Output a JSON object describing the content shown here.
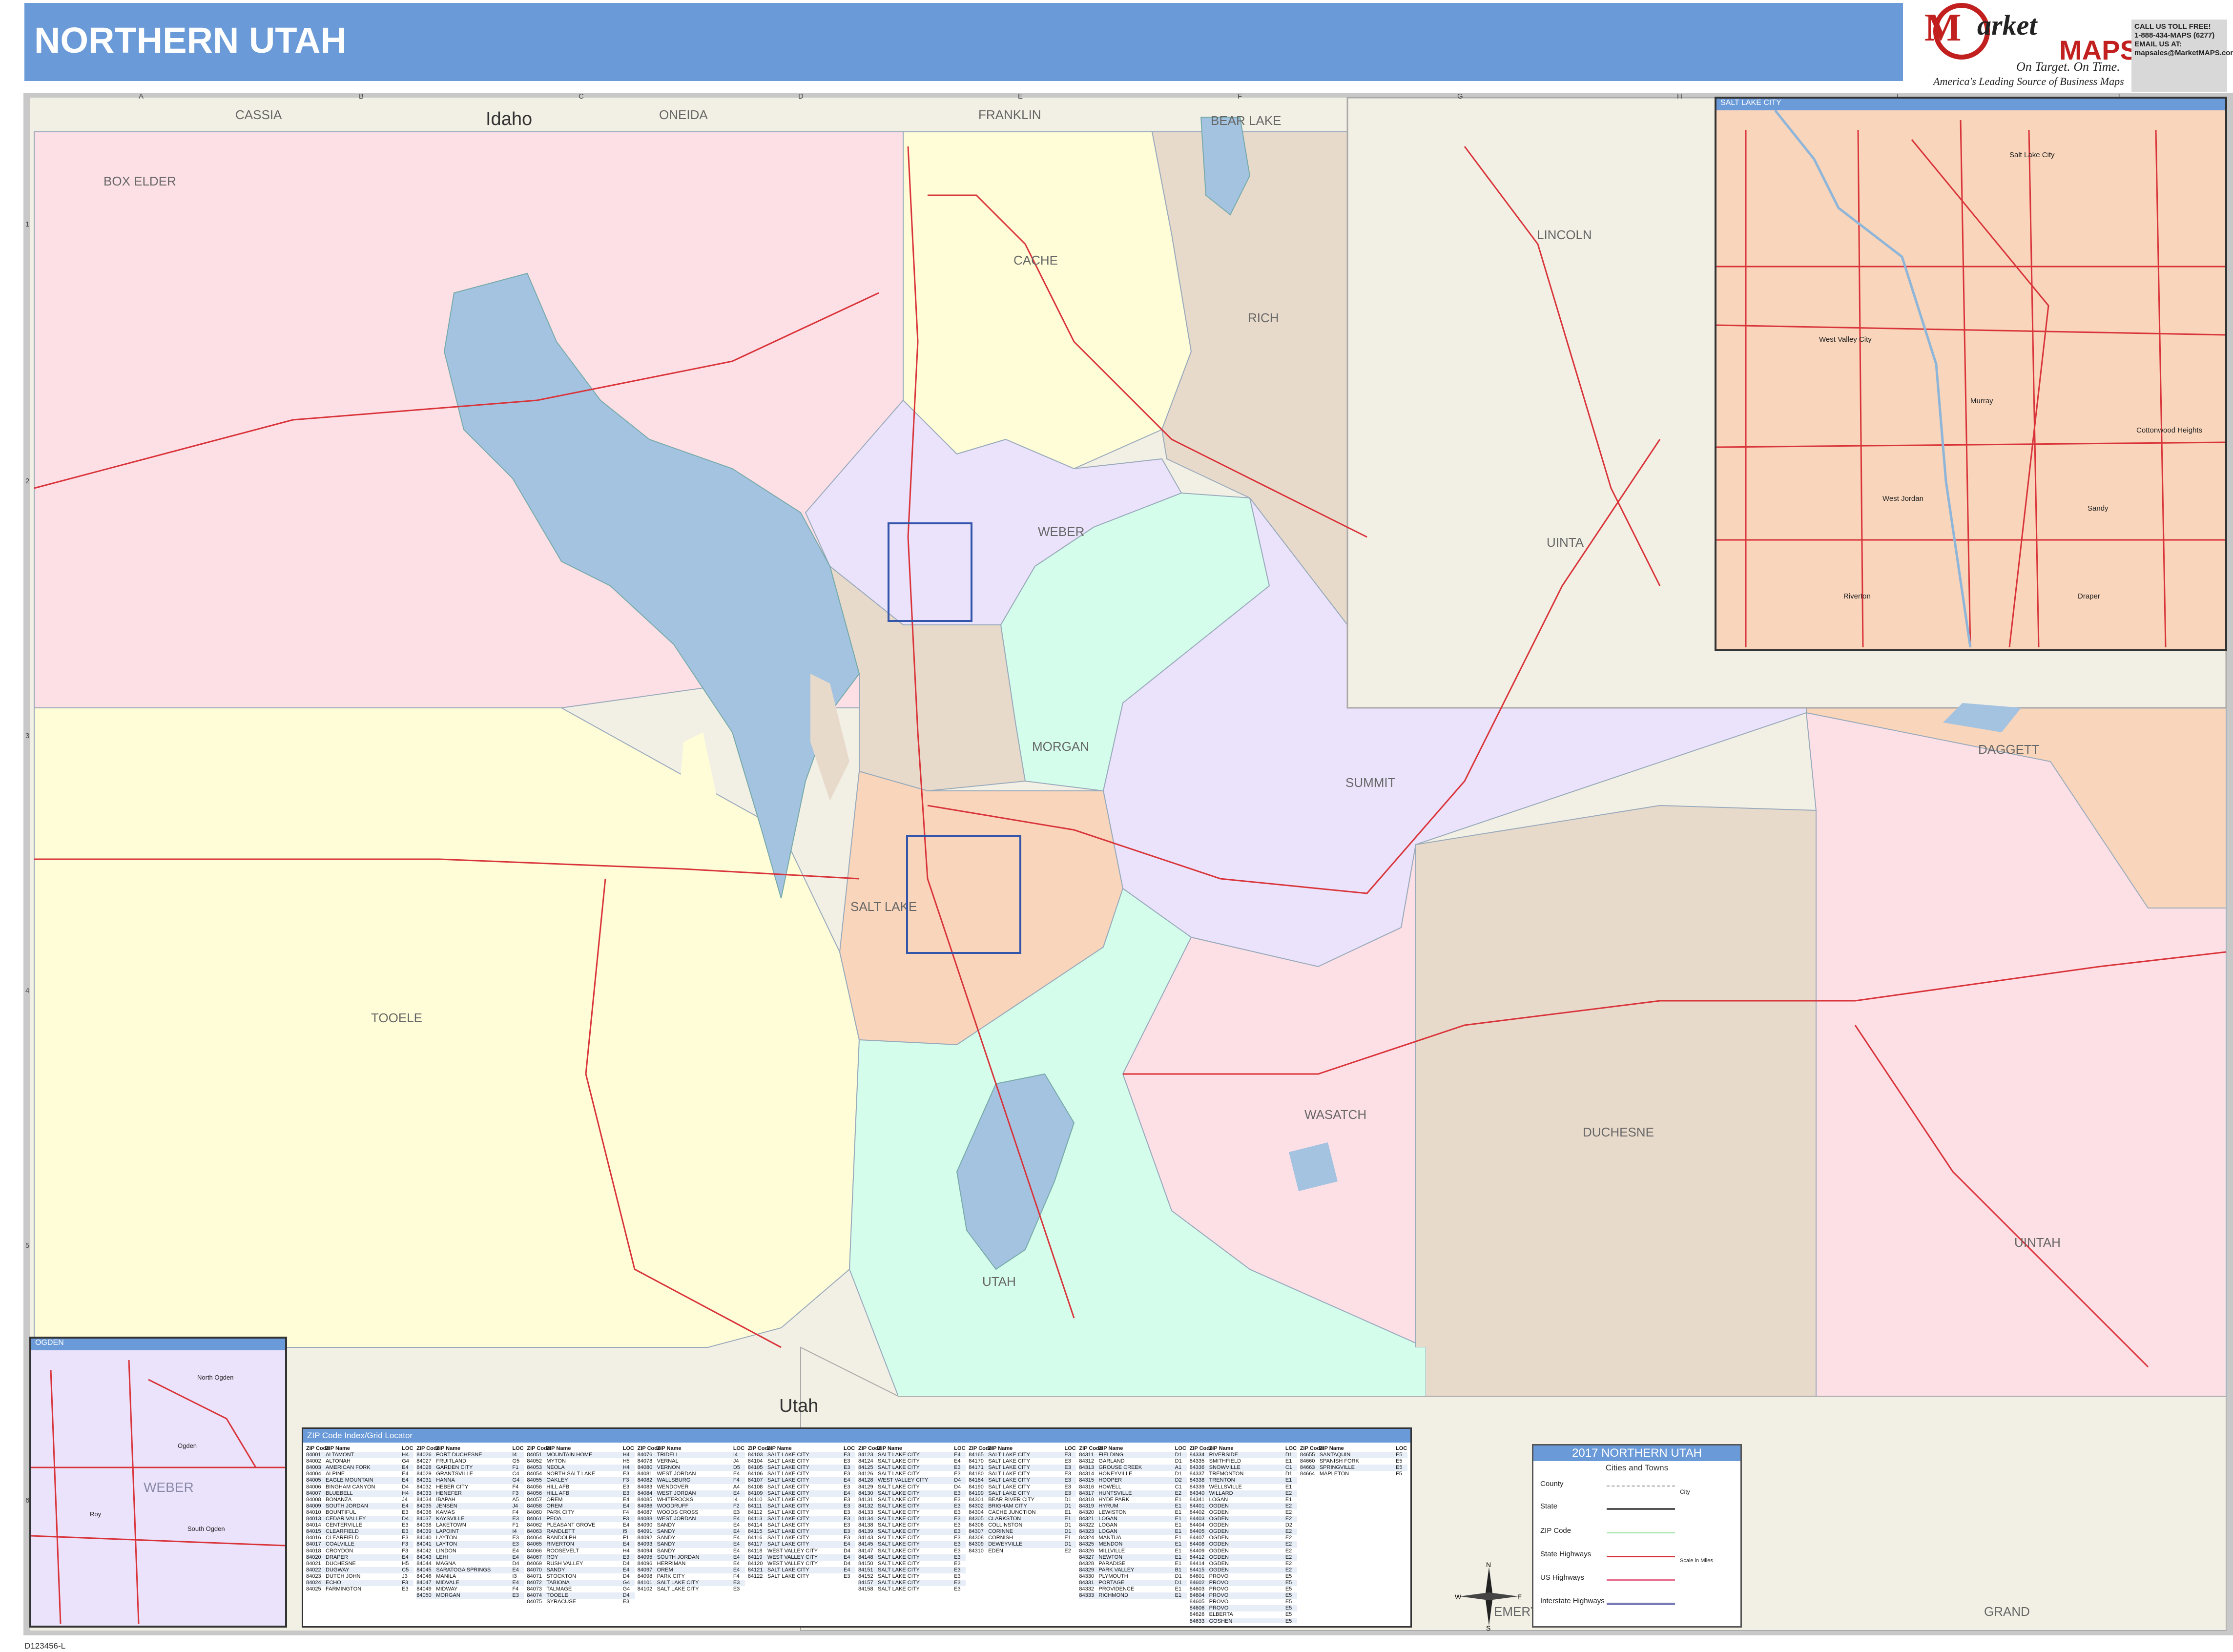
{
  "title": "NORTHERN UTAH",
  "logo": {
    "m_letter": "M",
    "market": "arket",
    "maps": "MAPS",
    "tagline": "On Target. On Time.",
    "subtag": "America's Leading Source of Business Maps"
  },
  "contact": {
    "line1": "CALL US TOLL FREE!",
    "line2": "1-888-434-MAPS (6277)",
    "line3": "EMAIL US AT:",
    "line4": "mapsales@MarketMAPS.com"
  },
  "footer_code": "D123456-L",
  "grid": {
    "columns": [
      "A",
      "B",
      "C",
      "D",
      "E",
      "F",
      "G",
      "H",
      "I",
      "J"
    ],
    "rows": [
      "1",
      "2",
      "3",
      "4",
      "5",
      "6"
    ]
  },
  "labels": {
    "states": [
      "Idaho",
      "Utah"
    ],
    "counties": [
      "CASSIA",
      "ONEIDA",
      "FRANKLIN",
      "BEAR LAKE",
      "BOX ELDER",
      "CACHE",
      "RICH",
      "LINCOLN",
      "UINTA",
      "WEBER",
      "MORGAN",
      "SUMMIT",
      "DAGGETT",
      "SALT LAKE",
      "TOOELE",
      "WASATCH",
      "DUCHESNE",
      "UINTAH",
      "UTAH",
      "EMERY",
      "GRAND"
    ]
  },
  "colors": {
    "box_elder": "#fde0e6",
    "tooele": "#fefdd8",
    "cache": "#fefdd8",
    "rich": "#e8dacb",
    "weber": "#ebe3fb",
    "morgan": "#d5fdeb",
    "summit": "#ebe3fb",
    "salt_lake": "#f8d5bb",
    "utah": "#d5fdeb",
    "wasatch": "#fde0e6",
    "duchesne": "#e8dacb",
    "uintah": "#fde0e6",
    "daggett": "#f8d5bb",
    "wyoming": "#f2efe4",
    "water": "#a3c3e0",
    "road": "#d9343a",
    "title_bar": "#6a9ad8"
  },
  "insets": {
    "slc": {
      "title": "SALT LAKE CITY",
      "places": [
        "Salt Lake City",
        "West Valley City",
        "Murray",
        "Sandy",
        "West Jordan",
        "Draper",
        "Cottonwood Heights",
        "Riverton"
      ]
    },
    "ogden": {
      "title": "OGDEN",
      "county": "WEBER",
      "places": [
        "North Ogden",
        "Ogden",
        "Roy",
        "South Ogden"
      ]
    }
  },
  "zip_index": {
    "title": "ZIP Code Index/Grid Locator",
    "header": [
      "ZIP Code",
      "ZIP Name",
      "LOC"
    ],
    "columns": [
      [
        [
          "84001",
          "ALTAMONT",
          "H4"
        ],
        [
          "84002",
          "ALTONAH",
          "G4"
        ],
        [
          "84003",
          "AMERICAN FORK",
          "E4"
        ],
        [
          "84004",
          "ALPINE",
          "E4"
        ],
        [
          "84005",
          "EAGLE MOUNTAIN",
          "E4"
        ],
        [
          "84006",
          "BINGHAM CANYON",
          "D4"
        ],
        [
          "84007",
          "BLUEBELL",
          "H4"
        ],
        [
          "84008",
          "BONANZA",
          "J4"
        ],
        [
          "84009",
          "SOUTH JORDAN",
          "E4"
        ],
        [
          "84010",
          "BOUNTIFUL",
          "E3"
        ],
        [
          "84013",
          "CEDAR VALLEY",
          "D4"
        ],
        [
          "84014",
          "CENTERVILLE",
          "E3"
        ],
        [
          "84015",
          "CLEARFIELD",
          "E3"
        ],
        [
          "84016",
          "CLEARFIELD",
          "E3"
        ],
        [
          "84017",
          "COALVILLE",
          "F3"
        ],
        [
          "84018",
          "CROYDON",
          "F3"
        ],
        [
          "84020",
          "DRAPER",
          "E4"
        ],
        [
          "84021",
          "DUCHESNE",
          "H5"
        ],
        [
          "84022",
          "DUGWAY",
          "C5"
        ],
        [
          "84023",
          "DUTCH JOHN",
          "J3"
        ],
        [
          "84024",
          "ECHO",
          "F3"
        ],
        [
          "84025",
          "FARMINGTON",
          "E3"
        ]
      ],
      [
        [
          "84026",
          "FORT DUCHESNE",
          "I4"
        ],
        [
          "84027",
          "FRUITLAND",
          "G5"
        ],
        [
          "84028",
          "GARDEN CITY",
          "F1"
        ],
        [
          "84029",
          "GRANTSVILLE",
          "C4"
        ],
        [
          "84031",
          "HANNA",
          "G4"
        ],
        [
          "84032",
          "HEBER CITY",
          "F4"
        ],
        [
          "84033",
          "HENEFER",
          "F3"
        ],
        [
          "84034",
          "IBAPAH",
          "A5"
        ],
        [
          "84035",
          "JENSEN",
          "J4"
        ],
        [
          "84036",
          "KAMAS",
          "F4"
        ],
        [
          "84037",
          "KAYSVILLE",
          "E3"
        ],
        [
          "84038",
          "LAKETOWN",
          "F1"
        ],
        [
          "84039",
          "LAPOINT",
          "I4"
        ],
        [
          "84040",
          "LAYTON",
          "E3"
        ],
        [
          "84041",
          "LAYTON",
          "E3"
        ],
        [
          "84042",
          "LINDON",
          "E4"
        ],
        [
          "84043",
          "LEHI",
          "E4"
        ],
        [
          "84044",
          "MAGNA",
          "D4"
        ],
        [
          "84045",
          "SARATOGA SPRINGS",
          "E4"
        ],
        [
          "84046",
          "MANILA",
          "I3"
        ],
        [
          "84047",
          "MIDVALE",
          "E4"
        ],
        [
          "84049",
          "MIDWAY",
          "F4"
        ],
        [
          "84050",
          "MORGAN",
          "E3"
        ]
      ],
      [
        [
          "84051",
          "MOUNTAIN HOME",
          "H4"
        ],
        [
          "84052",
          "MYTON",
          "H5"
        ],
        [
          "84053",
          "NEOLA",
          "H4"
        ],
        [
          "84054",
          "NORTH SALT LAKE",
          "E3"
        ],
        [
          "84055",
          "OAKLEY",
          "F3"
        ],
        [
          "84056",
          "HILL AFB",
          "E3"
        ],
        [
          "84056",
          "HILL AFB",
          "E3"
        ],
        [
          "84057",
          "OREM",
          "E4"
        ],
        [
          "84058",
          "OREM",
          "E4"
        ],
        [
          "84060",
          "PARK CITY",
          "F4"
        ],
        [
          "84061",
          "PEOA",
          "F3"
        ],
        [
          "84062",
          "PLEASANT GROVE",
          "E4"
        ],
        [
          "84063",
          "RANDLETT",
          "I5"
        ],
        [
          "84064",
          "RANDOLPH",
          "F1"
        ],
        [
          "84065",
          "RIVERTON",
          "E4"
        ],
        [
          "84066",
          "ROOSEVELT",
          "H4"
        ],
        [
          "84067",
          "ROY",
          "E3"
        ],
        [
          "84069",
          "RUSH VALLEY",
          "D4"
        ],
        [
          "84070",
          "SANDY",
          "E4"
        ],
        [
          "84071",
          "STOCKTON",
          "D4"
        ],
        [
          "84072",
          "TABIONA",
          "G4"
        ],
        [
          "84073",
          "TALMAGE",
          "G4"
        ],
        [
          "84074",
          "TOOELE",
          "D4"
        ],
        [
          "84075",
          "SYRACUSE",
          "E3"
        ]
      ],
      [
        [
          "84076",
          "TRIDELL",
          "I4"
        ],
        [
          "84078",
          "VERNAL",
          "J4"
        ],
        [
          "84080",
          "VERNON",
          "D5"
        ],
        [
          "84081",
          "WEST JORDAN",
          "E4"
        ],
        [
          "84082",
          "WALLSBURG",
          "F4"
        ],
        [
          "84083",
          "WENDOVER",
          "A4"
        ],
        [
          "84084",
          "WEST JORDAN",
          "E4"
        ],
        [
          "84085",
          "WHITEROCKS",
          "I4"
        ],
        [
          "84086",
          "WOODRUFF",
          "F2"
        ],
        [
          "84087",
          "WOODS CROSS",
          "E3"
        ],
        [
          "84088",
          "WEST JORDAN",
          "E4"
        ],
        [
          "84090",
          "SANDY",
          "E4"
        ],
        [
          "84091",
          "SANDY",
          "E4"
        ],
        [
          "84092",
          "SANDY",
          "E4"
        ],
        [
          "84093",
          "SANDY",
          "E4"
        ],
        [
          "84094",
          "SANDY",
          "E4"
        ],
        [
          "84095",
          "SOUTH JORDAN",
          "E4"
        ],
        [
          "84096",
          "HERRIMAN",
          "E4"
        ],
        [
          "84097",
          "OREM",
          "E4"
        ],
        [
          "84098",
          "PARK CITY",
          "F4"
        ],
        [
          "84101",
          "SALT LAKE CITY",
          "E3"
        ],
        [
          "84102",
          "SALT LAKE CITY",
          "E3"
        ]
      ],
      [
        [
          "84103",
          "SALT LAKE CITY",
          "E3"
        ],
        [
          "84104",
          "SALT LAKE CITY",
          "E3"
        ],
        [
          "84105",
          "SALT LAKE CITY",
          "E3"
        ],
        [
          "84106",
          "SALT LAKE CITY",
          "E3"
        ],
        [
          "84107",
          "SALT LAKE CITY",
          "E4"
        ],
        [
          "84108",
          "SALT LAKE CITY",
          "E3"
        ],
        [
          "84109",
          "SALT LAKE CITY",
          "E4"
        ],
        [
          "84110",
          "SALT LAKE CITY",
          "E3"
        ],
        [
          "84111",
          "SALT LAKE CITY",
          "E3"
        ],
        [
          "84112",
          "SALT LAKE CITY",
          "E3"
        ],
        [
          "84113",
          "SALT LAKE CITY",
          "E3"
        ],
        [
          "84114",
          "SALT LAKE CITY",
          "E3"
        ],
        [
          "84115",
          "SALT LAKE CITY",
          "E3"
        ],
        [
          "84116",
          "SALT LAKE CITY",
          "E3"
        ],
        [
          "84117",
          "SALT LAKE CITY",
          "E4"
        ],
        [
          "84118",
          "WEST VALLEY CITY",
          "D4"
        ],
        [
          "84119",
          "WEST VALLEY CITY",
          "E4"
        ],
        [
          "84120",
          "WEST VALLEY CITY",
          "D4"
        ],
        [
          "84121",
          "SALT LAKE CITY",
          "E4"
        ],
        [
          "84122",
          "SALT LAKE CITY",
          "E3"
        ]
      ],
      [
        [
          "84123",
          "SALT LAKE CITY",
          "E4"
        ],
        [
          "84124",
          "SALT LAKE CITY",
          "E4"
        ],
        [
          "84125",
          "SALT LAKE CITY",
          "E3"
        ],
        [
          "84126",
          "SALT LAKE CITY",
          "E3"
        ],
        [
          "84128",
          "WEST VALLEY CITY",
          "D4"
        ],
        [
          "84129",
          "SALT LAKE CITY",
          "D4"
        ],
        [
          "84130",
          "SALT LAKE CITY",
          "E3"
        ],
        [
          "84131",
          "SALT LAKE CITY",
          "E3"
        ],
        [
          "84132",
          "SALT LAKE CITY",
          "E3"
        ],
        [
          "84133",
          "SALT LAKE CITY",
          "E3"
        ],
        [
          "84134",
          "SALT LAKE CITY",
          "E3"
        ],
        [
          "84138",
          "SALT LAKE CITY",
          "E3"
        ],
        [
          "84139",
          "SALT LAKE CITY",
          "E3"
        ],
        [
          "84143",
          "SALT LAKE CITY",
          "E3"
        ],
        [
          "84145",
          "SALT LAKE CITY",
          "E3"
        ],
        [
          "84147",
          "SALT LAKE CITY",
          "E3"
        ],
        [
          "84148",
          "SALT LAKE CITY",
          "E3"
        ],
        [
          "84150",
          "SALT LAKE CITY",
          "E3"
        ],
        [
          "84151",
          "SALT LAKE CITY",
          "E3"
        ],
        [
          "84152",
          "SALT LAKE CITY",
          "E3"
        ],
        [
          "84157",
          "SALT LAKE CITY",
          "E3"
        ],
        [
          "84158",
          "SALT LAKE CITY",
          "E3"
        ]
      ],
      [
        [
          "84165",
          "SALT LAKE CITY",
          "E3"
        ],
        [
          "84170",
          "SALT LAKE CITY",
          "E3"
        ],
        [
          "84171",
          "SALT LAKE CITY",
          "E3"
        ],
        [
          "84180",
          "SALT LAKE CITY",
          "E3"
        ],
        [
          "84184",
          "SALT LAKE CITY",
          "E3"
        ],
        [
          "84190",
          "SALT LAKE CITY",
          "E3"
        ],
        [
          "84199",
          "SALT LAKE CITY",
          "E3"
        ],
        [
          "84301",
          "BEAR RIVER CITY",
          "D1"
        ],
        [
          "84302",
          "BRIGHAM CITY",
          "D1"
        ],
        [
          "84304",
          "CACHE JUNCTION",
          "E1"
        ],
        [
          "84305",
          "CLARKSTON",
          "E1"
        ],
        [
          "84306",
          "COLLINSTON",
          "D1"
        ],
        [
          "84307",
          "CORINNE",
          "D1"
        ],
        [
          "84308",
          "CORNISH",
          "E1"
        ],
        [
          "84309",
          "DEWEYVILLE",
          "D1"
        ],
        [
          "84310",
          "EDEN",
          "E2"
        ]
      ],
      [
        [
          "84311",
          "FIELDING",
          "D1"
        ],
        [
          "84312",
          "GARLAND",
          "D1"
        ],
        [
          "84313",
          "GROUSE CREEK",
          "A1"
        ],
        [
          "84314",
          "HONEYVILLE",
          "D1"
        ],
        [
          "84315",
          "HOOPER",
          "D2"
        ],
        [
          "84316",
          "HOWELL",
          "C1"
        ],
        [
          "84317",
          "HUNTSVILLE",
          "E2"
        ],
        [
          "84318",
          "HYDE PARK",
          "E1"
        ],
        [
          "84319",
          "HYRUM",
          "E1"
        ],
        [
          "84320",
          "LEWISTON",
          "E1"
        ],
        [
          "84321",
          "LOGAN",
          "E1"
        ],
        [
          "84322",
          "LOGAN",
          "E1"
        ],
        [
          "84323",
          "LOGAN",
          "E1"
        ],
        [
          "84324",
          "MANTUA",
          "E1"
        ],
        [
          "84325",
          "MENDON",
          "E1"
        ],
        [
          "84326",
          "MILLVILLE",
          "E1"
        ],
        [
          "84327",
          "NEWTON",
          "E1"
        ],
        [
          "84328",
          "PARADISE",
          "E1"
        ],
        [
          "84329",
          "PARK VALLEY",
          "B1"
        ],
        [
          "84330",
          "PLYMOUTH",
          "D1"
        ],
        [
          "84331",
          "PORTAGE",
          "D1"
        ],
        [
          "84332",
          "PROVIDENCE",
          "E1"
        ],
        [
          "84333",
          "RICHMOND",
          "E1"
        ]
      ],
      [
        [
          "84334",
          "RIVERSIDE",
          "D1"
        ],
        [
          "84335",
          "SMITHFIELD",
          "E1"
        ],
        [
          "84336",
          "SNOWVILLE",
          "C1"
        ],
        [
          "84337",
          "TREMONTON",
          "D1"
        ],
        [
          "84338",
          "TRENTON",
          "E1"
        ],
        [
          "84339",
          "WELLSVILLE",
          "E1"
        ],
        [
          "84340",
          "WILLARD",
          "E2"
        ],
        [
          "84341",
          "LOGAN",
          "E1"
        ],
        [
          "84401",
          "OGDEN",
          "E2"
        ],
        [
          "84402",
          "OGDEN",
          "E2"
        ],
        [
          "84403",
          "OGDEN",
          "E2"
        ],
        [
          "84404",
          "OGDEN",
          "D2"
        ],
        [
          "84405",
          "OGDEN",
          "E2"
        ],
        [
          "84407",
          "OGDEN",
          "E2"
        ],
        [
          "84408",
          "OGDEN",
          "E2"
        ],
        [
          "84409",
          "OGDEN",
          "E2"
        ],
        [
          "84412",
          "OGDEN",
          "E2"
        ],
        [
          "84414",
          "OGDEN",
          "E2"
        ],
        [
          "84415",
          "OGDEN",
          "E2"
        ],
        [
          "84601",
          "PROVO",
          "E5"
        ],
        [
          "84602",
          "PROVO",
          "E5"
        ],
        [
          "84603",
          "PROVO",
          "E5"
        ],
        [
          "84604",
          "PROVO",
          "E5"
        ],
        [
          "84605",
          "PROVO",
          "E5"
        ],
        [
          "84606",
          "PROVO",
          "E5"
        ],
        [
          "84626",
          "ELBERTA",
          "E5"
        ],
        [
          "84633",
          "GOSHEN",
          "E5"
        ],
        [
          "84651",
          "PAYSON",
          "E5"
        ],
        [
          "84653",
          "SALEM",
          "E5"
        ]
      ],
      [
        [
          "84655",
          "SANTAQUIN",
          "E5"
        ],
        [
          "84660",
          "SPANISH FORK",
          "E5"
        ],
        [
          "84663",
          "SPRINGVILLE",
          "E5"
        ],
        [
          "84664",
          "MAPLETON",
          "F5"
        ]
      ]
    ]
  },
  "legend": {
    "title": "2017 NORTHERN UTAH",
    "subtitle": "Cities and Towns",
    "items": [
      "County",
      "State",
      "ZIP Code",
      "State Highways",
      "US Highways",
      "Interstate Highways"
    ],
    "sample_city": "City",
    "scale_label": "Scale in Miles"
  },
  "compass": {
    "n": "N",
    "s": "S",
    "e": "E",
    "w": "W"
  }
}
